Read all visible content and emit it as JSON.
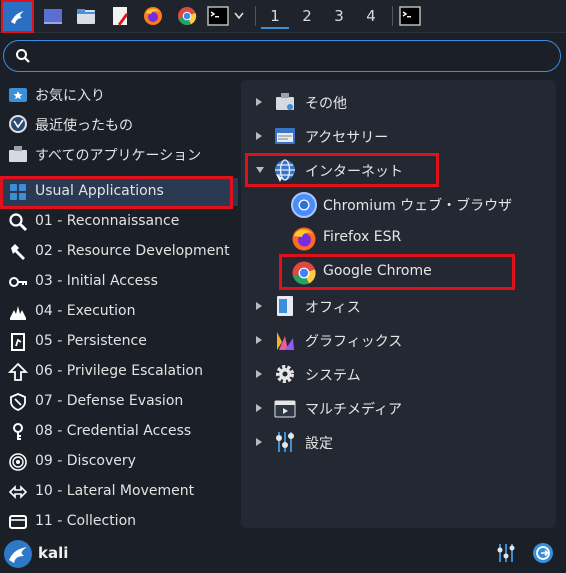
{
  "taskbar": {
    "workspaces": [
      "1",
      "2",
      "3",
      "4"
    ]
  },
  "search": {
    "value": "",
    "placeholder": ""
  },
  "categories": [
    {
      "label": "お気に入り",
      "icon": "favorites-icon"
    },
    {
      "label": "最近使ったもの",
      "icon": "recent-icon"
    },
    {
      "label": "すべてのアプリケーション",
      "icon": "all-apps-icon"
    },
    {
      "label": "Usual Applications",
      "icon": "usual-apps-icon"
    },
    {
      "label": "01 - Reconnaissance",
      "icon": "recon-icon"
    },
    {
      "label": "02 - Resource Development",
      "icon": "resource-dev-icon"
    },
    {
      "label": "03 - Initial Access",
      "icon": "initial-access-icon"
    },
    {
      "label": "04 - Execution",
      "icon": "execution-icon"
    },
    {
      "label": "05 - Persistence",
      "icon": "persistence-icon"
    },
    {
      "label": "06 - Privilege Escalation",
      "icon": "privilege-escalation-icon"
    },
    {
      "label": "07 - Defense Evasion",
      "icon": "defense-evasion-icon"
    },
    {
      "label": "08 - Credential Access",
      "icon": "credential-access-icon"
    },
    {
      "label": "09 - Discovery",
      "icon": "discovery-icon"
    },
    {
      "label": "10 - Lateral Movement",
      "icon": "lateral-movement-icon"
    },
    {
      "label": "11 - Collection",
      "icon": "collection-icon"
    }
  ],
  "submenu": {
    "other": "その他",
    "accessories": "アクセサリー",
    "internet": "インターネット",
    "apps": [
      {
        "label": "Chromium ウェブ・ブラウザ",
        "icon": "chromium-icon"
      },
      {
        "label": "Firefox ESR",
        "icon": "firefox-icon"
      },
      {
        "label": "Google Chrome",
        "icon": "chrome-icon"
      }
    ],
    "office": "オフィス",
    "graphics": "グラフィックス",
    "system": "システム",
    "multimedia": "マルチメディア",
    "settings": "設定"
  },
  "bottom": {
    "username": "kali"
  },
  "colors": {
    "accent": "#3b8ee0",
    "highlight": "#e0111b",
    "panel": "#232833",
    "background": "#1b1f27"
  }
}
